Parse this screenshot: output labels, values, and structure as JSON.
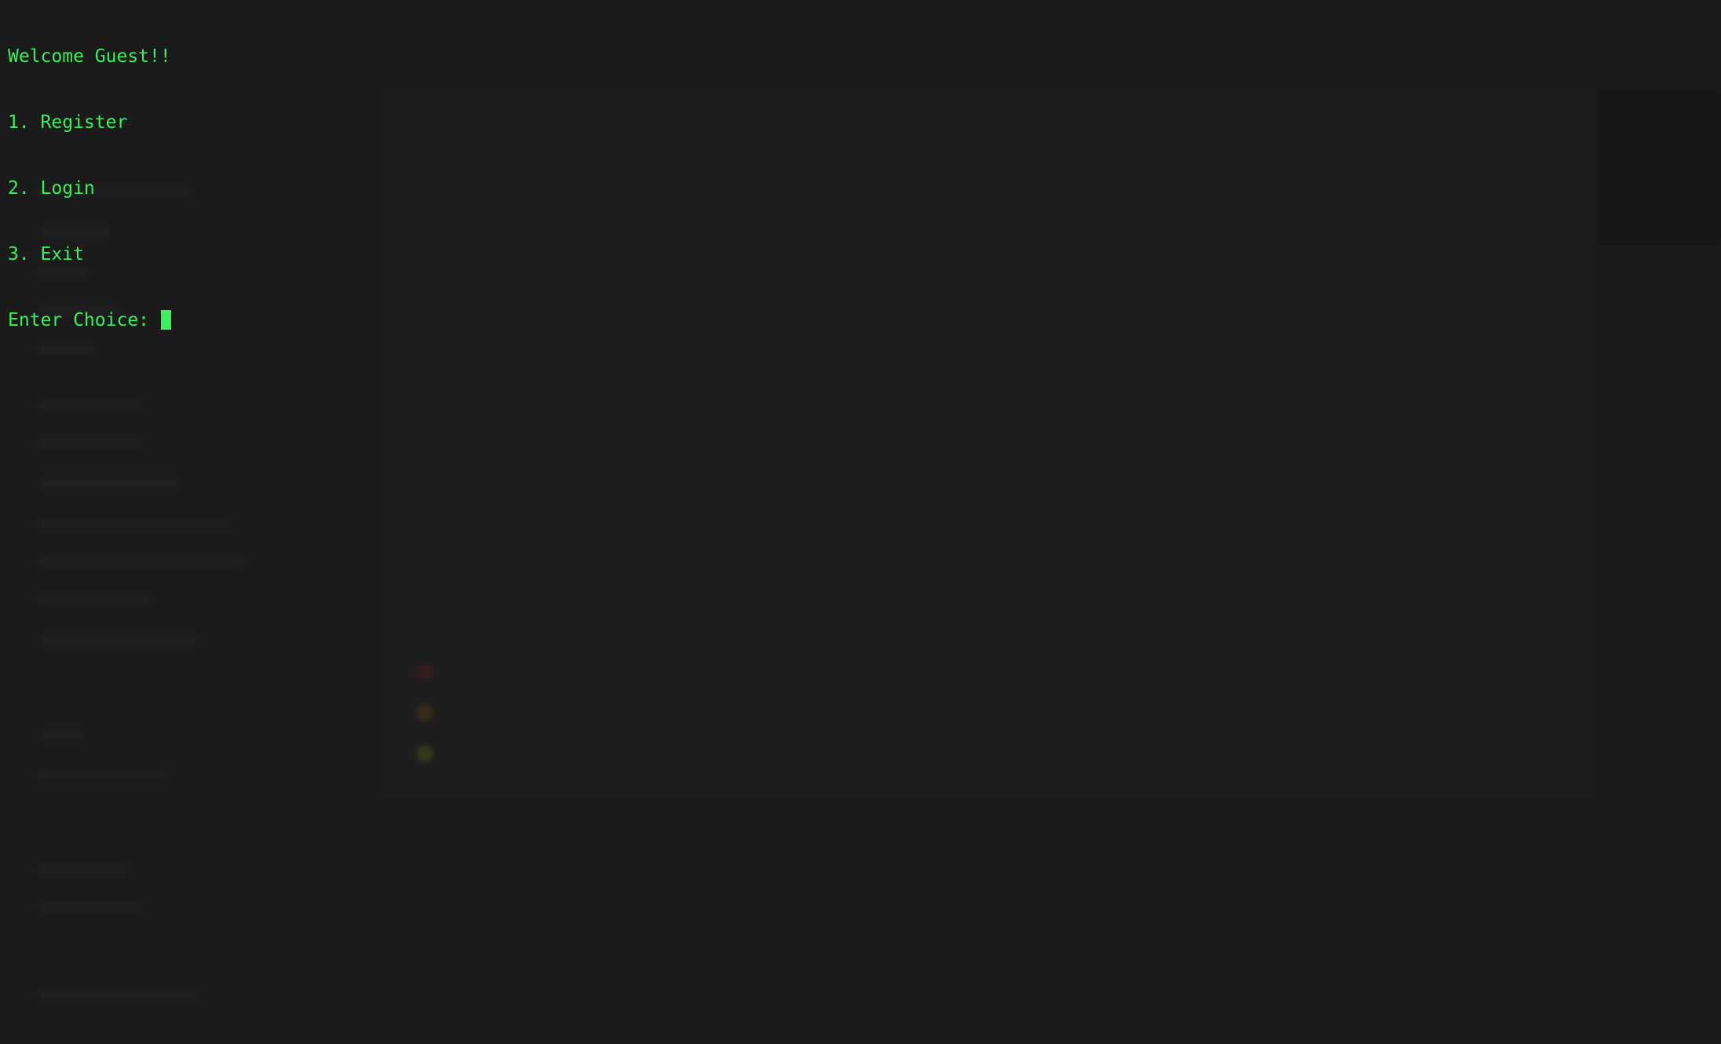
{
  "terminal": {
    "lines": [
      "Welcome Guest!!",
      "1. Register",
      "2. Login",
      "3. Exit"
    ],
    "prompt": "Enter Choice: ",
    "input_value": "",
    "text_color": "#3cf05a"
  },
  "colors": {
    "background": "#1a1a1a"
  }
}
